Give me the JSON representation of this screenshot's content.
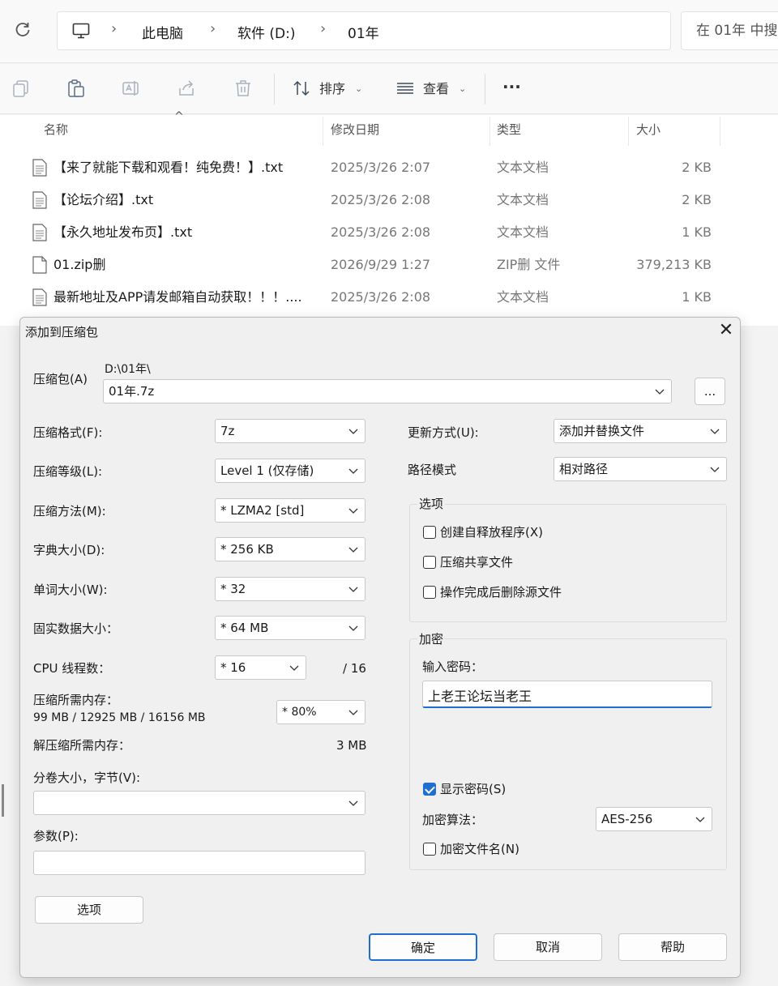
{
  "explorer": {
    "breadcrumbs": [
      "此电脑",
      "软件 (D:)",
      "01年"
    ],
    "search_placeholder": "在 01年 中搜",
    "toolbar": {
      "sort_label": "排序",
      "view_label": "查看",
      "more_label": "···"
    },
    "columns": {
      "name": "名称",
      "date": "修改日期",
      "type": "类型",
      "size": "大小"
    },
    "files": [
      {
        "name": "【来了就能下载和观看！纯免费！】.txt",
        "date": "2025/3/26 2:07",
        "type": "文本文档",
        "size": "2 KB"
      },
      {
        "name": "【论坛介绍】.txt",
        "date": "2025/3/26 2:08",
        "type": "文本文档",
        "size": "2 KB"
      },
      {
        "name": "【永久地址发布页】.txt",
        "date": "2025/3/26 2:08",
        "type": "文本文档",
        "size": "1 KB"
      },
      {
        "name": "01.zip删",
        "date": "2026/9/29 1:27",
        "type": "ZIP删 文件",
        "size": "379,213 KB"
      },
      {
        "name": "最新地址及APP请发邮箱自动获取！！！....",
        "date": "2025/3/26 2:08",
        "type": "文本文档",
        "size": "1 KB"
      }
    ]
  },
  "dialog": {
    "title": "添加到压缩包",
    "archive_label": "压缩包(A)",
    "archive_path": "D:\\01年\\",
    "archive_name": "01年.7z",
    "browse_label": "...",
    "left": {
      "format_label": "压缩格式(F):",
      "format_value": "7z",
      "level_label": "压缩等级(L):",
      "level_value": "Level 1 (仅存储)",
      "method_label": "压缩方法(M):",
      "method_value": "*  LZMA2 [std]",
      "dict_label": "字典大小(D):",
      "dict_value": "*  256 KB",
      "word_label": "单词大小(W):",
      "word_value": "*  32",
      "solid_label": "固实数据大小：",
      "solid_value": "*  64 MB",
      "threads_label": "CPU 线程数：",
      "threads_value": "*  16",
      "threads_total": "/ 16",
      "mem_label": "压缩所需内存：",
      "mem_value": "99 MB / 12925 MB / 16156 MB",
      "mem_percent": "* 80%",
      "decomp_label": "解压缩所需内存：",
      "decomp_value": "3 MB",
      "volume_label": "分卷大小，字节(V):",
      "volume_value": "",
      "params_label": "参数(P):",
      "params_value": "",
      "options_button": "选项"
    },
    "right": {
      "update_label": "更新方式(U):",
      "update_value": "添加并替换文件",
      "path_label": "路径模式",
      "path_value": "相对路径",
      "options_group": "选项",
      "opt_sfx": "创建自释放程序(X)",
      "opt_sfx_checked": false,
      "opt_shared": "压缩共享文件",
      "opt_shared_checked": false,
      "opt_delete": "操作完成后删除源文件",
      "opt_delete_checked": false,
      "encrypt_group": "加密",
      "password_label": "输入密码：",
      "password_value": "上老王论坛当老王",
      "show_password": "显示密码(S)",
      "show_password_checked": true,
      "algo_label": "加密算法：",
      "algo_value": "AES-256",
      "encrypt_names": "加密文件名(N)",
      "encrypt_names_checked": false
    },
    "buttons": {
      "ok": "确定",
      "cancel": "取消",
      "help": "帮助"
    }
  },
  "colors": {
    "accent": "#1f6fd1",
    "ok_border": "#1f6fd1"
  }
}
